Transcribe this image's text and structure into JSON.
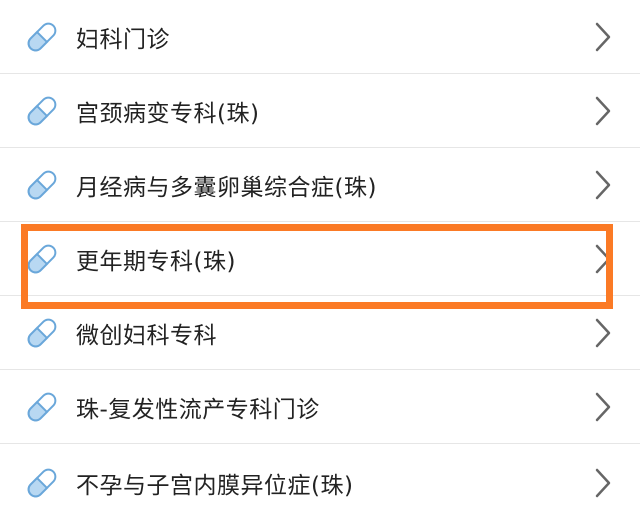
{
  "items": [
    {
      "label": "妇科门诊",
      "icon": "pill-icon"
    },
    {
      "label": "宫颈病变专科(珠)",
      "icon": "pill-icon"
    },
    {
      "label": "月经病与多囊卵巢综合症(珠)",
      "icon": "pill-icon"
    },
    {
      "label": "更年期专科(珠)",
      "icon": "pill-icon",
      "highlighted": true
    },
    {
      "label": "微创妇科专科",
      "icon": "pill-icon"
    },
    {
      "label": "珠-复发性流产专科门诊",
      "icon": "pill-icon"
    },
    {
      "label": "不孕与子宫内膜异位症(珠)",
      "icon": "pill-icon"
    }
  ],
  "colors": {
    "icon_fill": "#b8d8f2",
    "icon_stroke": "#6aa7da",
    "chevron": "#666666",
    "highlight_border": "#fb7a25",
    "divider": "#e6e6e6"
  }
}
